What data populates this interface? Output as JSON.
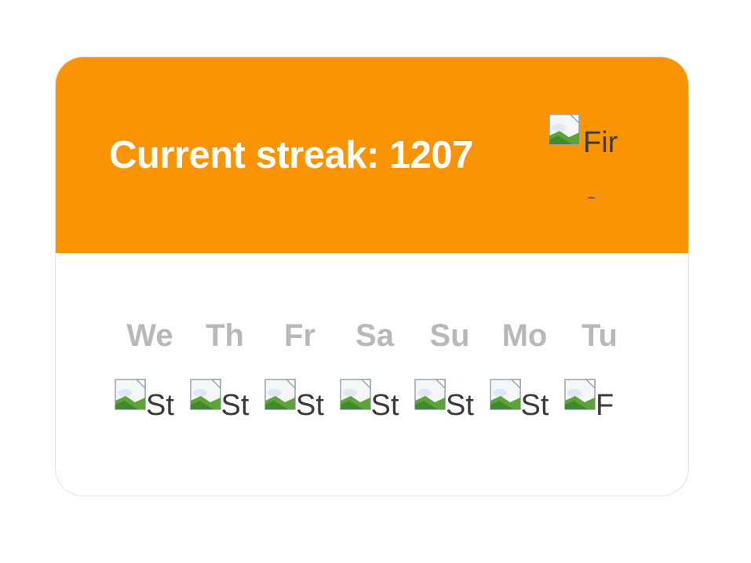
{
  "colors": {
    "accent": "#fb9405",
    "day_label": "#b8b8b8",
    "card_border": "#e2e2e2"
  },
  "header": {
    "title": "Current streak: 1207",
    "image": {
      "icon": "broken-image-icon",
      "alt_text": "Fire"
    }
  },
  "week": {
    "days": [
      {
        "label": "We",
        "icon": "broken-image-icon",
        "alt_text": "St"
      },
      {
        "label": "Th",
        "icon": "broken-image-icon",
        "alt_text": "St"
      },
      {
        "label": "Fr",
        "icon": "broken-image-icon",
        "alt_text": "St"
      },
      {
        "label": "Sa",
        "icon": "broken-image-icon",
        "alt_text": "St"
      },
      {
        "label": "Su",
        "icon": "broken-image-icon",
        "alt_text": "St"
      },
      {
        "label": "Mo",
        "icon": "broken-image-icon",
        "alt_text": "St"
      },
      {
        "label": "Tu",
        "icon": "broken-image-icon",
        "alt_text": "F"
      }
    ]
  }
}
